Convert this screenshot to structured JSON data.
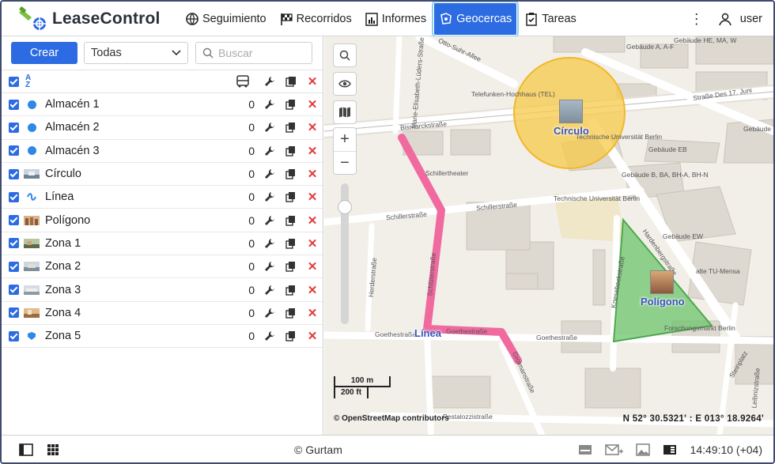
{
  "app": {
    "title": "LeaseControl"
  },
  "nav": [
    {
      "label": "Seguimiento",
      "icon": "globe-icon"
    },
    {
      "label": "Recorridos",
      "icon": "checkered-flag-icon"
    },
    {
      "label": "Informes",
      "icon": "report-chart-icon"
    },
    {
      "label": "Geocercas",
      "icon": "geofence-icon",
      "active": true
    },
    {
      "label": "Tareas",
      "icon": "task-check-icon"
    }
  ],
  "user": {
    "name": "user"
  },
  "toolbar": {
    "create_label": "Crear",
    "filter_value": "Todas",
    "search_placeholder": "Buscar"
  },
  "geofences": [
    {
      "name": "Almacén 1",
      "count": "0",
      "icon": "dot"
    },
    {
      "name": "Almacén 2",
      "count": "0",
      "icon": "dot"
    },
    {
      "name": "Almacén 3",
      "count": "0",
      "icon": "dot"
    },
    {
      "name": "Círculo",
      "count": "0",
      "icon": "thumb"
    },
    {
      "name": "Línea",
      "count": "0",
      "icon": "line"
    },
    {
      "name": "Polígono",
      "count": "0",
      "icon": "thumb"
    },
    {
      "name": "Zona 1",
      "count": "0",
      "icon": "thumb"
    },
    {
      "name": "Zona 2",
      "count": "0",
      "icon": "thumb"
    },
    {
      "name": "Zona 3",
      "count": "0",
      "icon": "thumb"
    },
    {
      "name": "Zona 4",
      "count": "0",
      "icon": "thumb"
    },
    {
      "name": "Zona 5",
      "count": "0",
      "icon": "pin"
    }
  ],
  "map": {
    "fence_labels": {
      "circle": "Círculo",
      "line": "Línea",
      "polygon": "Polígono"
    },
    "streets": {
      "s1": "Otto-Suhr-Allee",
      "s2": "Bismarckstraße",
      "s3": "Schillerstraße",
      "s4": "Schillerstraße",
      "s5": "Goethestraße",
      "s6": "Goethestraße",
      "s7": "Goethestraße",
      "s8": "Pestalozzistraße",
      "s9": "Straße Des 17. Juni",
      "s10": "Hardenbergstraße",
      "s11": "Technische Universität Berlin",
      "s12": "Schillertheater",
      "s13": "Telefunken-Hochhaus (TEL)",
      "s14": "Gebäude HE, MA, W",
      "s15": "Gebäude A, A-F",
      "s16": "Gebäude EB",
      "s17": "Gebäude EW",
      "s18": "alte TU-Mensa",
      "s19": "Forschungsmarkt Berlin",
      "s20": "Steinplatz",
      "s21": "Schlüterstraße",
      "s22": "Knesebeckstraße",
      "s23": "Gebäude B, BA, BH-A, BH-N",
      "s24": "Herderstraße",
      "s25": "Leibnizstraße",
      "s26": "Marie-Elisabeth-Lüders-Straße",
      "s27": "Grolmanstraße",
      "s28": "Gebäude EN",
      "s29": "Technische Universität Berlin"
    },
    "scale_m": "100 m",
    "scale_ft": "200 ft",
    "attribution": "© OpenStreetMap contributors",
    "coordinates": "N 52° 30.5321' : E 013° 18.9264'"
  },
  "footer": {
    "copyright": "© Gurtam",
    "time": "14:49:10 (+04)"
  },
  "colors": {
    "accent": "#2d6be2",
    "circle_fence": "#f7c948",
    "line_fence": "#f06aa0",
    "polygon_fence": "#6cc46c"
  }
}
